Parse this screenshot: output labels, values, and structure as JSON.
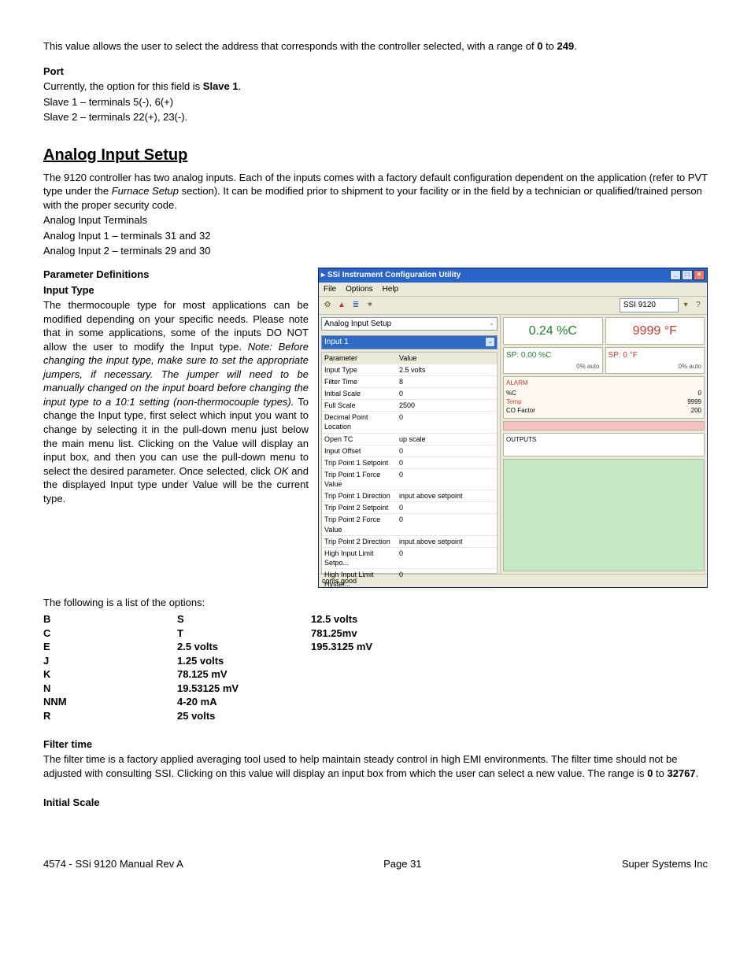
{
  "intro_text": "This value allows the user to select the address that corresponds with the controller selected, with a range of ",
  "intro_range_a": "0",
  "intro_mid": " to ",
  "intro_range_b": "249",
  "intro_end": ".",
  "port": {
    "heading": "Port",
    "l1a": "Currently, the option for this field is ",
    "l1b": "Slave 1",
    "l1c": ".",
    "l2": "Slave 1 – terminals 5(-), 6(+)",
    "l3": "Slave 2 – terminals 22(+), 23(-)."
  },
  "analog": {
    "heading": "Analog Input Setup",
    "p1a": "The 9120 controller has two analog inputs. Each of the inputs comes with a factory default configuration dependent on the application (refer to PVT type under the ",
    "p1b": "Furnace Setup",
    "p1c": " section).  It can be modified prior to shipment to your facility or in the field by a technician or qualified/trained person with the proper security code.",
    "p2": "Analog Input Terminals",
    "p3": "Analog Input 1 – terminals 31 and 32",
    "p4": "Analog Input 2 – terminals 29 and 30"
  },
  "param_def": {
    "h1": "Parameter Definitions",
    "h2": "Input Type",
    "t1": "The thermocouple type for most applications can be modified depending on your specific needs. Please note that in some applications, some of the inputs DO NOT allow the user to modify the Input type. ",
    "t2": "Note: Before changing the input type, make sure to set the appropriate jumpers, if necessary.  The jumper will need to be manually changed on the input board before changing the input type to a 10:1 setting (non-thermocouple types).",
    "t3": "  To change the Input type, first select which input you want to change by selecting it in the pull-down menu just below the main menu list. Clicking on the Value will display an input box, and then you can use the pull-down menu to select the desired parameter.  Once selected, click ",
    "t4": "OK",
    "t5": " and the displayed Input type under Value will be the current type."
  },
  "options_intro": "The following is a list of the options:",
  "options": {
    "col1": [
      "B",
      "C",
      "E",
      "J",
      "K",
      "N",
      "NNM",
      "R"
    ],
    "col2": [
      "S",
      "T",
      "2.5 volts",
      "1.25 volts",
      "78.125 mV",
      "19.53125 mV",
      "4-20 mA",
      "25 volts"
    ],
    "col3": [
      "12.5 volts",
      "781.25mv",
      "195.3125 mV"
    ]
  },
  "filter": {
    "h": "Filter time",
    "t1": "The filter time is a factory applied averaging tool used to help maintain steady control in high EMI environments. The filter time should not be adjusted with consulting SSI.  Clicking on this value will display an input box from which the user can select a new value.  The range is ",
    "r1": "0",
    "mid": " to ",
    "r2": "32767",
    "end": "."
  },
  "initial_scale_h": "Initial Scale",
  "footer": {
    "left": "4574 - SSi 9120 Manual Rev A",
    "center": "Page 31",
    "right": "Super Systems Inc"
  },
  "screenshot": {
    "title": "SSi Instrument Configuration Utility",
    "menus": [
      "File",
      "Options",
      "Help"
    ],
    "device": "SSI 9120",
    "dd1": "Analog Input Setup",
    "dd2": "Input 1",
    "header": {
      "c1": "Parameter",
      "c2": "Value"
    },
    "rows": [
      {
        "p": "Input Type",
        "v": "2.5 volts"
      },
      {
        "p": "Filter Time",
        "v": "8"
      },
      {
        "p": "Initial Scale",
        "v": "0"
      },
      {
        "p": "Full Scale",
        "v": "2500"
      },
      {
        "p": "Decimal Point Location",
        "v": "0"
      },
      {
        "p": "Open TC",
        "v": "up scale"
      },
      {
        "p": "Input Offset",
        "v": "0"
      },
      {
        "p": "Trip Point 1 Setpoint",
        "v": "0"
      },
      {
        "p": "Trip Point 1 Force Value",
        "v": "0"
      },
      {
        "p": "Trip Point 1 Direction",
        "v": "input above setpoint"
      },
      {
        "p": "Trip Point 2 Setpoint",
        "v": "0"
      },
      {
        "p": "Trip Point 2 Force Value",
        "v": "0"
      },
      {
        "p": "Trip Point 2 Direction",
        "v": "input above setpoint"
      },
      {
        "p": "High Input Limit Setpo...",
        "v": "0"
      },
      {
        "p": "High Input Limit Hyster...",
        "v": "0"
      }
    ],
    "pv1": "0.24 %C",
    "pv2": "9999 °F",
    "sp1": "SP: 0.00 %C",
    "sp2": "SP: 0 °F",
    "sub": "0%     auto",
    "alarm_title": "ALARM",
    "alarm_rows": [
      {
        "k": "%C",
        "v": "0"
      },
      {
        "k": "Temp",
        "v": "9999"
      },
      {
        "k": "CO Factor",
        "v": "200"
      }
    ],
    "outputs": "OUTPUTS",
    "status": "coms good"
  }
}
